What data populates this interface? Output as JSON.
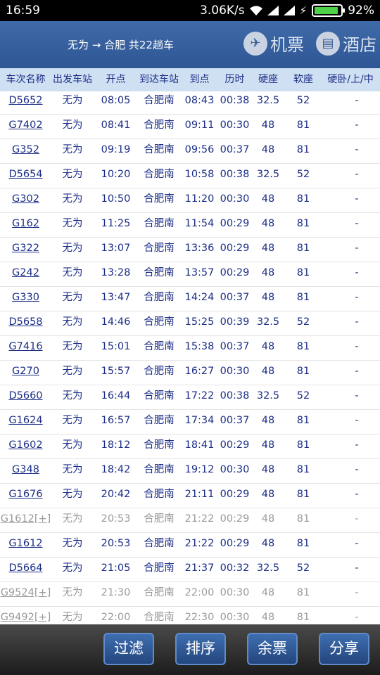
{
  "status_bar": {
    "time": "16:59",
    "speed": "3.06K/s",
    "battery": "92%",
    "battery_level": 0.92,
    "icons": [
      "wifi-icon",
      "signal-icon",
      "signal-icon",
      "charging-icon",
      "battery-icon"
    ]
  },
  "header": {
    "route": "无为 → 合肥 共22趟车",
    "flight_label": "机票",
    "hotel_label": "酒店",
    "flight_icon": "airplane-icon",
    "hotel_icon": "hotel-icon"
  },
  "columns": [
    "车次名称",
    "出发车站",
    "开点",
    "到达车站",
    "到点",
    "历时",
    "硬座",
    "软座",
    "硬卧/上/中"
  ],
  "rows": [
    {
      "train": "D5652",
      "from": "无为",
      "dep": "08:05",
      "to": "合肥南",
      "arr": "08:43",
      "dur": "00:38",
      "hard_seat": "32.5",
      "soft_seat": "52",
      "hard_sleeper": "-",
      "gray": false
    },
    {
      "train": "G7402",
      "from": "无为",
      "dep": "08:41",
      "to": "合肥南",
      "arr": "09:11",
      "dur": "00:30",
      "hard_seat": "48",
      "soft_seat": "81",
      "hard_sleeper": "-",
      "gray": false
    },
    {
      "train": "G352",
      "from": "无为",
      "dep": "09:19",
      "to": "合肥南",
      "arr": "09:56",
      "dur": "00:37",
      "hard_seat": "48",
      "soft_seat": "81",
      "hard_sleeper": "-",
      "gray": false
    },
    {
      "train": "D5654",
      "from": "无为",
      "dep": "10:20",
      "to": "合肥南",
      "arr": "10:58",
      "dur": "00:38",
      "hard_seat": "32.5",
      "soft_seat": "52",
      "hard_sleeper": "-",
      "gray": false
    },
    {
      "train": "G302",
      "from": "无为",
      "dep": "10:50",
      "to": "合肥南",
      "arr": "11:20",
      "dur": "00:30",
      "hard_seat": "48",
      "soft_seat": "81",
      "hard_sleeper": "-",
      "gray": false
    },
    {
      "train": "G162",
      "from": "无为",
      "dep": "11:25",
      "to": "合肥南",
      "arr": "11:54",
      "dur": "00:29",
      "hard_seat": "48",
      "soft_seat": "81",
      "hard_sleeper": "-",
      "gray": false
    },
    {
      "train": "G322",
      "from": "无为",
      "dep": "13:07",
      "to": "合肥南",
      "arr": "13:36",
      "dur": "00:29",
      "hard_seat": "48",
      "soft_seat": "81",
      "hard_sleeper": "-",
      "gray": false
    },
    {
      "train": "G242",
      "from": "无为",
      "dep": "13:28",
      "to": "合肥南",
      "arr": "13:57",
      "dur": "00:29",
      "hard_seat": "48",
      "soft_seat": "81",
      "hard_sleeper": "-",
      "gray": false
    },
    {
      "train": "G330",
      "from": "无为",
      "dep": "13:47",
      "to": "合肥南",
      "arr": "14:24",
      "dur": "00:37",
      "hard_seat": "48",
      "soft_seat": "81",
      "hard_sleeper": "-",
      "gray": false
    },
    {
      "train": "D5658",
      "from": "无为",
      "dep": "14:46",
      "to": "合肥南",
      "arr": "15:25",
      "dur": "00:39",
      "hard_seat": "32.5",
      "soft_seat": "52",
      "hard_sleeper": "-",
      "gray": false
    },
    {
      "train": "G7416",
      "from": "无为",
      "dep": "15:01",
      "to": "合肥南",
      "arr": "15:38",
      "dur": "00:37",
      "hard_seat": "48",
      "soft_seat": "81",
      "hard_sleeper": "-",
      "gray": false
    },
    {
      "train": "G270",
      "from": "无为",
      "dep": "15:57",
      "to": "合肥南",
      "arr": "16:27",
      "dur": "00:30",
      "hard_seat": "48",
      "soft_seat": "81",
      "hard_sleeper": "-",
      "gray": false
    },
    {
      "train": "D5660",
      "from": "无为",
      "dep": "16:44",
      "to": "合肥南",
      "arr": "17:22",
      "dur": "00:38",
      "hard_seat": "32.5",
      "soft_seat": "52",
      "hard_sleeper": "-",
      "gray": false
    },
    {
      "train": "G1624",
      "from": "无为",
      "dep": "16:57",
      "to": "合肥南",
      "arr": "17:34",
      "dur": "00:37",
      "hard_seat": "48",
      "soft_seat": "81",
      "hard_sleeper": "-",
      "gray": false
    },
    {
      "train": "G1602",
      "from": "无为",
      "dep": "18:12",
      "to": "合肥南",
      "arr": "18:41",
      "dur": "00:29",
      "hard_seat": "48",
      "soft_seat": "81",
      "hard_sleeper": "-",
      "gray": false
    },
    {
      "train": "G348",
      "from": "无为",
      "dep": "18:42",
      "to": "合肥南",
      "arr": "19:12",
      "dur": "00:30",
      "hard_seat": "48",
      "soft_seat": "81",
      "hard_sleeper": "-",
      "gray": false
    },
    {
      "train": "G1676",
      "from": "无为",
      "dep": "20:42",
      "to": "合肥南",
      "arr": "21:11",
      "dur": "00:29",
      "hard_seat": "48",
      "soft_seat": "81",
      "hard_sleeper": "-",
      "gray": false
    },
    {
      "train": "G1612[+]",
      "from": "无为",
      "dep": "20:53",
      "to": "合肥南",
      "arr": "21:22",
      "dur": "00:29",
      "hard_seat": "48",
      "soft_seat": "81",
      "hard_sleeper": "-",
      "gray": true
    },
    {
      "train": "G1612",
      "from": "无为",
      "dep": "20:53",
      "to": "合肥南",
      "arr": "21:22",
      "dur": "00:29",
      "hard_seat": "48",
      "soft_seat": "81",
      "hard_sleeper": "-",
      "gray": false
    },
    {
      "train": "D5664",
      "from": "无为",
      "dep": "21:05",
      "to": "合肥南",
      "arr": "21:37",
      "dur": "00:32",
      "hard_seat": "32.5",
      "soft_seat": "52",
      "hard_sleeper": "-",
      "gray": false
    },
    {
      "train": "G9524[+]",
      "from": "无为",
      "dep": "21:30",
      "to": "合肥南",
      "arr": "22:00",
      "dur": "00:30",
      "hard_seat": "48",
      "soft_seat": "81",
      "hard_sleeper": "-",
      "gray": true
    },
    {
      "train": "G9492[+]",
      "from": "无为",
      "dep": "22:00",
      "to": "合肥南",
      "arr": "22:30",
      "dur": "00:30",
      "hard_seat": "48",
      "soft_seat": "81",
      "hard_sleeper": "-",
      "gray": true
    }
  ],
  "bottom_bar": {
    "filter": "过滤",
    "sort": "排序",
    "remaining": "余票",
    "share": "分享"
  },
  "colors": {
    "header_bg": "#2f5694",
    "column_header_bg": "#cfe0f2",
    "text_blue": "#1c2e86",
    "text_gray": "#9a9a9a",
    "button_bg": "#2c528e"
  }
}
